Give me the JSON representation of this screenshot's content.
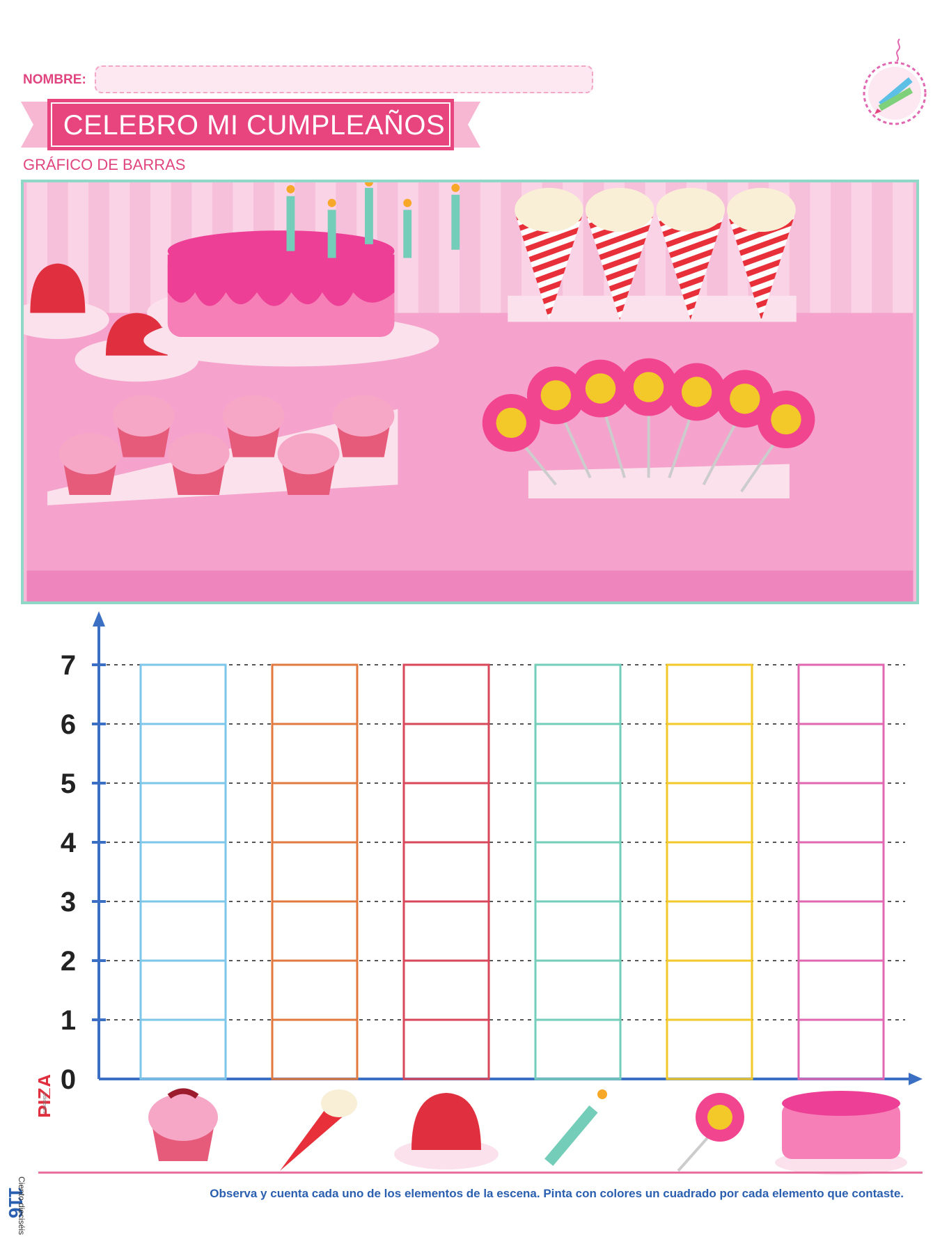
{
  "header": {
    "name_label": "NOMBRE:",
    "title": "CELEBRO MI CUMPLEAÑOS",
    "subtitle": "GRÁFICO DE BARRAS"
  },
  "chart_data": {
    "type": "bar",
    "title": "",
    "xlabel": "",
    "ylabel": "",
    "ylim": [
      0,
      7
    ],
    "yticks": [
      "0",
      "1",
      "2",
      "3",
      "4",
      "5",
      "6",
      "7"
    ],
    "categories": [
      "cupcake-icon",
      "popcorn-cone-icon",
      "jelly-icon",
      "candle-icon",
      "lollipop-icon",
      "cake-icon"
    ],
    "column_colors": [
      "#7cc6ea",
      "#e07a3f",
      "#d9485a",
      "#73cdb8",
      "#f2c928",
      "#e067b0"
    ],
    "values": [
      null,
      null,
      null,
      null,
      null,
      null
    ],
    "grid": true
  },
  "footer": {
    "instructions": "Observa y cuenta cada uno de los elementos de la escena. Pinta con colores un cuadrado por cada elemento que contaste.",
    "page_number": "116",
    "page_words": "Ciento dieciséis",
    "publisher_logo_text": "PIZA",
    "publisher_small_text": "ediciones"
  },
  "colors": {
    "accent_pink": "#e0457f",
    "axis_blue": "#3b6fc4",
    "scene_border": "#8fd8c8"
  }
}
